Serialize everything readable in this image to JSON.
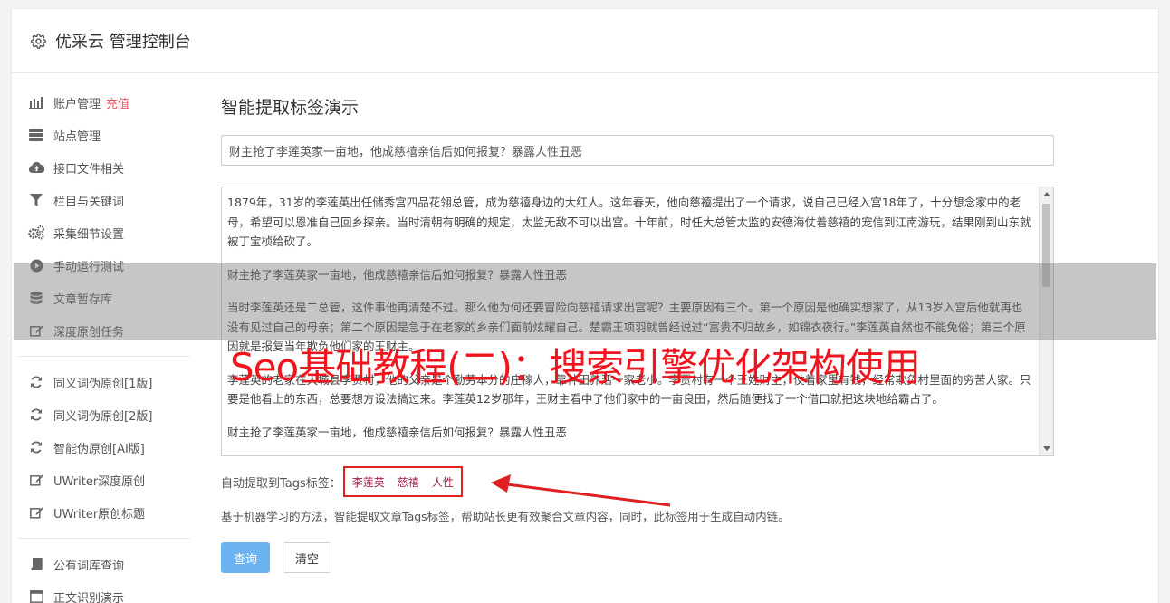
{
  "header": {
    "title": "优采云 管理控制台",
    "icon": "gear-icon"
  },
  "sidebar": {
    "groups": [
      [
        {
          "label": "账户管理",
          "badge": "充值",
          "icon": "bar-chart-icon"
        },
        {
          "label": "站点管理",
          "icon": "server-icon"
        },
        {
          "label": "接口文件相关",
          "icon": "cloud-upload-icon"
        },
        {
          "label": "栏目与关键词",
          "icon": "filter-icon"
        },
        {
          "label": "采集细节设置",
          "icon": "gears-icon"
        },
        {
          "label": "手动运行测试",
          "icon": "play-icon"
        },
        {
          "label": "文章暂存库",
          "icon": "database-icon"
        },
        {
          "label": "深度原创任务",
          "icon": "edit-icon"
        }
      ],
      [
        {
          "label": "同义词伪原创[1版]",
          "icon": "refresh-icon"
        },
        {
          "label": "同义词伪原创[2版]",
          "icon": "refresh-icon"
        },
        {
          "label": "智能伪原创[AI版]",
          "icon": "refresh-icon"
        },
        {
          "label": "UWriter深度原创",
          "icon": "edit-icon"
        },
        {
          "label": "UWriter原创标题",
          "icon": "edit-icon"
        }
      ],
      [
        {
          "label": "公有词库查询",
          "icon": "book-icon"
        },
        {
          "label": "正文识别演示",
          "icon": "window-icon"
        }
      ]
    ]
  },
  "main": {
    "heading": "智能提取标签演示",
    "title_value": "财主抢了李莲英家一亩地，他成慈禧亲信后如何报复？暴露人性丑恶",
    "content_paragraphs": [
      "1879年，31岁的李莲英出任储秀宫四品花翎总管，成为慈禧身边的大红人。这年春天，他向慈禧提出了一个请求，说自己已经入宫18年了，十分想念家中的老母，希望可以恩准自己回乡探亲。当时清朝有明确的规定，太监无敌不可以出宫。十年前，时任大总管太监的安德海仗着慈禧的宠信到江南游玩，结果刚到山东就被丁宝桢给砍了。",
      "财主抢了李莲英家一亩地，他成慈禧亲信后如何报复？暴露人性丑恶",
      "当时李莲英还是二总管，这件事他再清楚不过。那么他为何还要冒险向慈禧请求出宫呢？主要原因有三个。第一个原因是他确实想家了，从13岁入宫后他就再也没有见过自己的母亲；第二个原因是急于在老家的乡亲们面前炫耀自己。楚霸王项羽就曾经说过“富贵不归故乡，如锦衣夜行。”李莲英自然也不能免俗；第三个原因就是报复当年欺负他们家的王财主。",
      "李莲英的老家在大城县李贾村，他的父亲是个勤劳本分的庄稼人，靠种田养活一家老小。李贾村有一个王姓财主，仗着家里有钱，经常欺负村里面的穷苦人家。只要是他看上的东西，总要想方设法搞过来。李莲英12岁那年，王财主看中了他们家中的一亩良田，然后随便找了一个借口就把这块地给霸占了。",
      "财主抢了李莲英家一亩地，他成慈禧亲信后如何报复？暴露人性丑恶"
    ],
    "tags_label": "自动提取到Tags标签：",
    "tags": [
      "李莲英",
      "慈禧",
      "人性"
    ],
    "description": "基于机器学习的方法，智能提取文章Tags标签，帮助站长更有效聚合文章内容，同时，此标签用于生成自动内链。",
    "query_button": "查询",
    "clear_button": "清空"
  },
  "overlay": {
    "text": "Seo基础教程(二)：搜索引擎优化架构使用",
    "text_color": "#f0141e",
    "band_color": "#787878"
  }
}
